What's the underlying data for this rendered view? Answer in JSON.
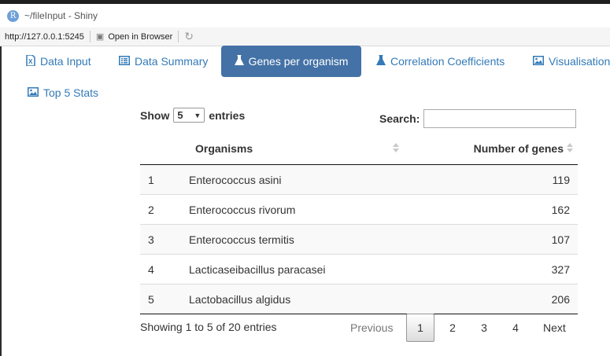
{
  "window": {
    "logo_letter": "R",
    "title": "~/fileInput - Shiny"
  },
  "addressbar": {
    "url": "http://127.0.0.1:5245",
    "open_label": "Open in Browser"
  },
  "tabs": [
    {
      "label": "Data Input",
      "icon": "file-excel-icon"
    },
    {
      "label": "Data Summary",
      "icon": "list-alt-icon"
    },
    {
      "label": "Genes per organism",
      "icon": "flask-icon",
      "active": true
    },
    {
      "label": "Correlation Coefficients",
      "icon": "flask-icon"
    },
    {
      "label": "Visualisation",
      "icon": "image-icon"
    },
    {
      "label": "Top 5 Stats",
      "icon": "image-icon"
    }
  ],
  "table_controls": {
    "show_label": "Show",
    "page_length": "5",
    "entries_label": "entries",
    "search_label": "Search:",
    "search_value": ""
  },
  "table": {
    "columns": [
      "",
      "Organisms",
      "Number of genes"
    ],
    "rows": [
      {
        "idx": "1",
        "organism": "Enterococcus asini",
        "genes": "119"
      },
      {
        "idx": "2",
        "organism": "Enterococcus rivorum",
        "genes": "162"
      },
      {
        "idx": "3",
        "organism": "Enterococcus termitis",
        "genes": "107"
      },
      {
        "idx": "4",
        "organism": "Lacticaseibacillus paracasei",
        "genes": "327"
      },
      {
        "idx": "5",
        "organism": "Lactobacillus algidus",
        "genes": "206"
      }
    ]
  },
  "pagination": {
    "info": "Showing 1 to 5 of 20 entries",
    "previous": "Previous",
    "pages": [
      "1",
      "2",
      "3",
      "4"
    ],
    "current_page": "1",
    "next": "Next"
  },
  "colors": {
    "accent": "#337ab7",
    "active_tab_bg": "#4472a6"
  }
}
